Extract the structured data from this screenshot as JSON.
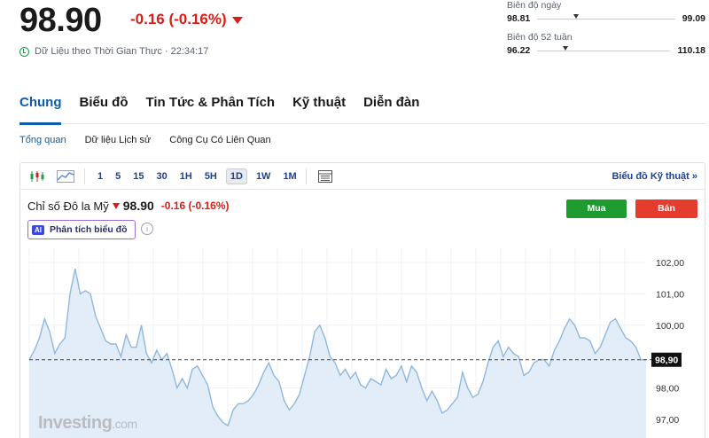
{
  "quote": {
    "price": "98.90",
    "change": "-0.16 (-0.16%)",
    "realtime_label": "Dữ Liệu theo Thời Gian Thực · 22:34:17"
  },
  "day_range": {
    "label": "Biên độ ngày",
    "low": "98.81",
    "high": "99.09",
    "marker_fraction": 0.26
  },
  "week52_range": {
    "label": "Biên độ 52 tuần",
    "low": "96.22",
    "high": "110.18",
    "marker_fraction": 0.19
  },
  "tabs": [
    {
      "label": "Chung",
      "active": true
    },
    {
      "label": "Biểu đồ"
    },
    {
      "label": "Tin Tức & Phân Tích"
    },
    {
      "label": "Kỹ thuật"
    },
    {
      "label": "Diễn đàn"
    }
  ],
  "subtabs": [
    "Tổng quan",
    "Dữ liệu Lịch sử",
    "Công Cụ Có Liên Quan"
  ],
  "toolbar": {
    "timeframes": [
      "1",
      "5",
      "15",
      "30",
      "1H",
      "5H",
      "1D",
      "1W",
      "1M"
    ],
    "selected": "1D",
    "tech_link": "Biểu đồ Kỹ thuật »"
  },
  "legend": {
    "name": "Chỉ số Đô la Mỹ",
    "value": "98.90",
    "change": "-0.16 (-0.16%)"
  },
  "ai_button": {
    "badge": "AI",
    "label": "Phân tích biểu đồ"
  },
  "buy_label": "Mua",
  "sell_label": "Bán",
  "watermark": {
    "brand": "Investing",
    "suffix": ".com"
  },
  "colors": {
    "down": "#d91e18",
    "buy": "#1e9b2f",
    "sell": "#e43d2e",
    "accent": "#0b5cad",
    "line": "#8fb8de",
    "fill": "#e3edf7"
  },
  "chart_data": {
    "type": "area",
    "yticks": [
      "102,00",
      "101,00",
      "100,00",
      "98,00",
      "97,00"
    ],
    "ylim": [
      96.7,
      102.4
    ],
    "current_label": "98,90",
    "current_value": 98.9,
    "values": [
      98.9,
      99.2,
      99.6,
      100.2,
      99.8,
      99.1,
      99.4,
      99.6,
      101.0,
      101.8,
      101.0,
      101.1,
      101.0,
      100.3,
      99.9,
      99.5,
      99.4,
      99.4,
      99.0,
      99.7,
      99.3,
      99.3,
      100.0,
      99.1,
      98.8,
      99.2,
      98.9,
      99.1,
      98.6,
      98.0,
      98.3,
      98.0,
      98.6,
      98.7,
      98.4,
      98.1,
      97.4,
      97.1,
      96.9,
      96.8,
      97.3,
      97.5,
      97.5,
      97.6,
      97.8,
      98.1,
      98.5,
      98.8,
      98.4,
      98.2,
      97.6,
      97.3,
      97.5,
      97.8,
      98.4,
      99.0,
      99.8,
      100.0,
      99.6,
      99.0,
      98.8,
      98.4,
      98.6,
      98.3,
      98.5,
      98.1,
      98.0,
      98.3,
      98.2,
      98.1,
      98.6,
      98.3,
      98.4,
      98.7,
      98.2,
      98.7,
      98.5,
      98.0,
      97.6,
      97.9,
      97.6,
      97.2,
      97.3,
      97.5,
      97.7,
      98.5,
      98.0,
      97.7,
      97.8,
      98.2,
      98.8,
      99.3,
      99.5,
      99.0,
      99.3,
      99.1,
      99.0,
      98.4,
      98.5,
      98.8,
      98.9,
      98.9,
      98.7,
      99.2,
      99.5,
      99.9,
      100.2,
      100.0,
      99.6,
      99.6,
      99.5,
      99.1,
      99.3,
      99.7,
      100.1,
      100.2,
      99.9,
      99.6,
      99.5,
      99.3,
      98.9,
      98.9
    ]
  }
}
